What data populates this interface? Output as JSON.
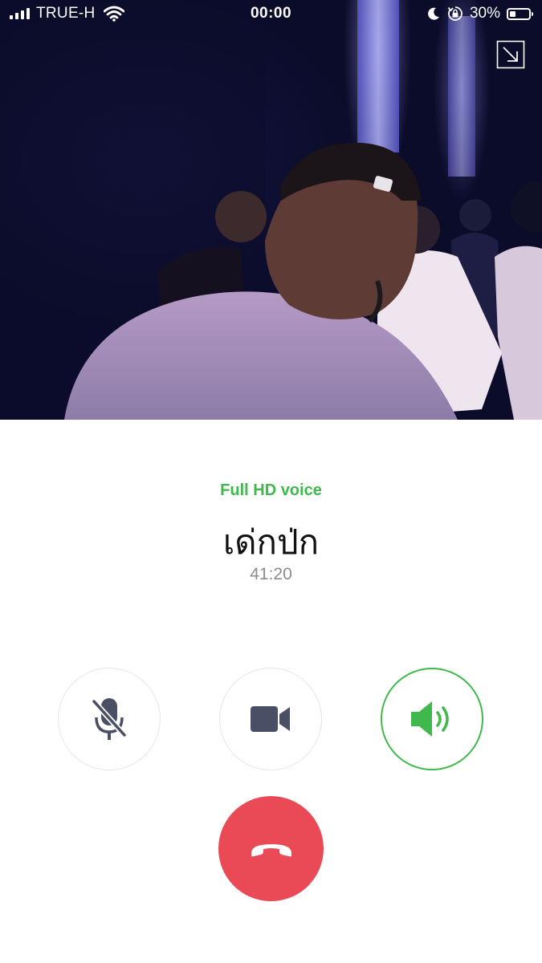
{
  "status_bar": {
    "carrier": "TRUE-H",
    "time": "00:00",
    "battery_percent": "30%",
    "icons": [
      "signal-icon",
      "wifi-icon",
      "moon-icon",
      "rotation-lock-icon",
      "battery-icon"
    ]
  },
  "header": {
    "minimize_icon": "minimize-arrow-icon"
  },
  "call": {
    "quality_label": "Full HD voice",
    "caller_name": "เด่กป่ก",
    "duration": "41:20"
  },
  "controls": {
    "mute": {
      "icon": "mic-off-icon",
      "active": false
    },
    "video": {
      "icon": "video-camera-icon",
      "active": false
    },
    "speaker": {
      "icon": "speaker-icon",
      "active": true
    },
    "end_call": {
      "icon": "hang-up-icon"
    }
  },
  "colors": {
    "accent_green": "#3fb84d",
    "end_call_red": "#e94a55",
    "icon_gray": "#4b4f66",
    "duration_gray": "#8c8c8c"
  }
}
